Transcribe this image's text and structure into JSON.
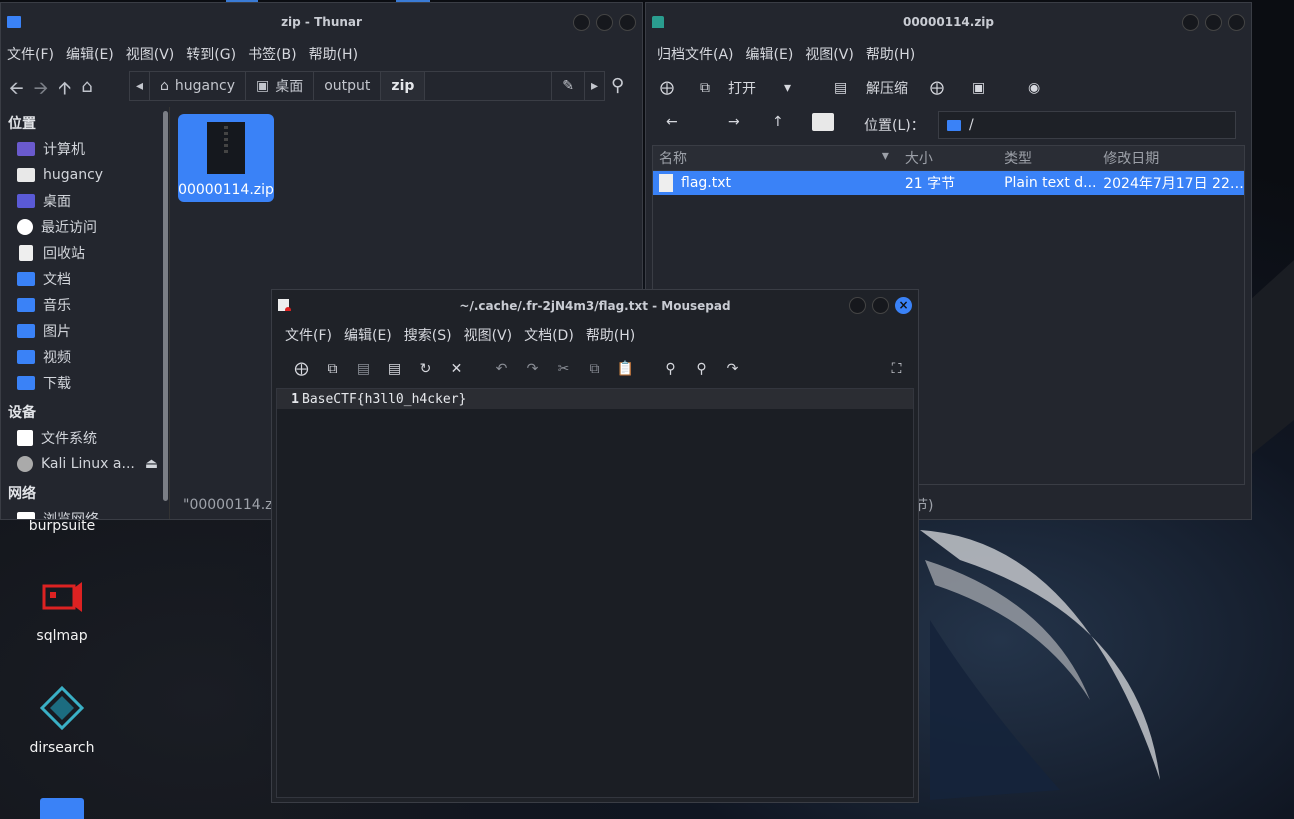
{
  "desktop": {
    "icons": [
      {
        "label": "burpsuite"
      },
      {
        "label": "sqlmap"
      },
      {
        "label": "dirsearch"
      }
    ]
  },
  "thunar": {
    "title": "zip - Thunar",
    "menu": [
      "文件(F)",
      "编辑(E)",
      "视图(V)",
      "转到(G)",
      "书签(B)",
      "帮助(H)"
    ],
    "path": [
      "hugancy",
      "桌面",
      "output",
      "zip"
    ],
    "sidebar": {
      "places_header": "位置",
      "places": [
        "计算机",
        "hugancy",
        "桌面",
        "最近访问",
        "回收站",
        "文档",
        "音乐",
        "图片",
        "视频",
        "下载"
      ],
      "devices_header": "设备",
      "devices": [
        "文件系统",
        "Kali Linux a..."
      ],
      "network_header": "网络",
      "network": [
        "浏览网络"
      ]
    },
    "file_name": "00000114.zip",
    "status": "\"00000114.zi"
  },
  "archive": {
    "title": "00000114.zip",
    "menu": [
      "归档文件(A)",
      "编辑(E)",
      "视图(V)",
      "帮助(H)"
    ],
    "open_label": "打开",
    "extract_label": "解压缩",
    "location_label": "位置(L)：",
    "location_value": "/",
    "columns": [
      "名称",
      "大小",
      "类型",
      "修改日期"
    ],
    "rows": [
      {
        "name": "flag.txt",
        "size": "21 字节",
        "type": "Plain text d...",
        "date": "2024年7月17日 22:..."
      }
    ],
    "status": "节)"
  },
  "mousepad": {
    "title": "~/.cache/.fr-2jN4m3/flag.txt - Mousepad",
    "menu": [
      "文件(F)",
      "编辑(E)",
      "搜索(S)",
      "视图(V)",
      "文档(D)",
      "帮助(H)"
    ],
    "line_number": "1",
    "content": "BaseCTF{h3ll0_h4cker}"
  },
  "colors": {
    "accent": "#3a82f7",
    "window_bg": "#23262e"
  }
}
